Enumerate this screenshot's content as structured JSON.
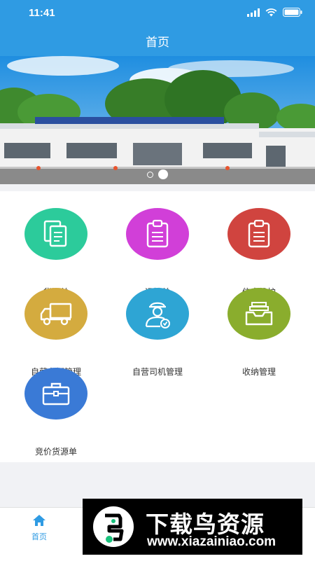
{
  "status_bar": {
    "time": "11:41"
  },
  "nav": {
    "title": "首页"
  },
  "banner": {
    "slide_count": 2,
    "active_slide": 2
  },
  "menu": {
    "items": [
      {
        "label": "货源单",
        "icon": "documents-icon",
        "color": "#2ccb9b"
      },
      {
        "label": "运输单",
        "icon": "clipboard-icon",
        "color": "#d13fd8"
      },
      {
        "label": "信息维护",
        "icon": "clipboard-icon",
        "color": "#d0443f"
      },
      {
        "label": "自营车辆管理",
        "icon": "truck-icon",
        "color": "#d4ab3f"
      },
      {
        "label": "自营司机管理",
        "icon": "driver-icon",
        "color": "#2ea5d4"
      },
      {
        "label": "收纳管理",
        "icon": "inbox-tray-icon",
        "color": "#8aad2d"
      },
      {
        "label": "竞价货源单",
        "icon": "briefcase-icon",
        "color": "#3a7ad6"
      }
    ]
  },
  "tabbar": {
    "home_label": "首页"
  },
  "watermark": {
    "title": "下载鸟资源",
    "url": "www.xiazainiao.com"
  }
}
